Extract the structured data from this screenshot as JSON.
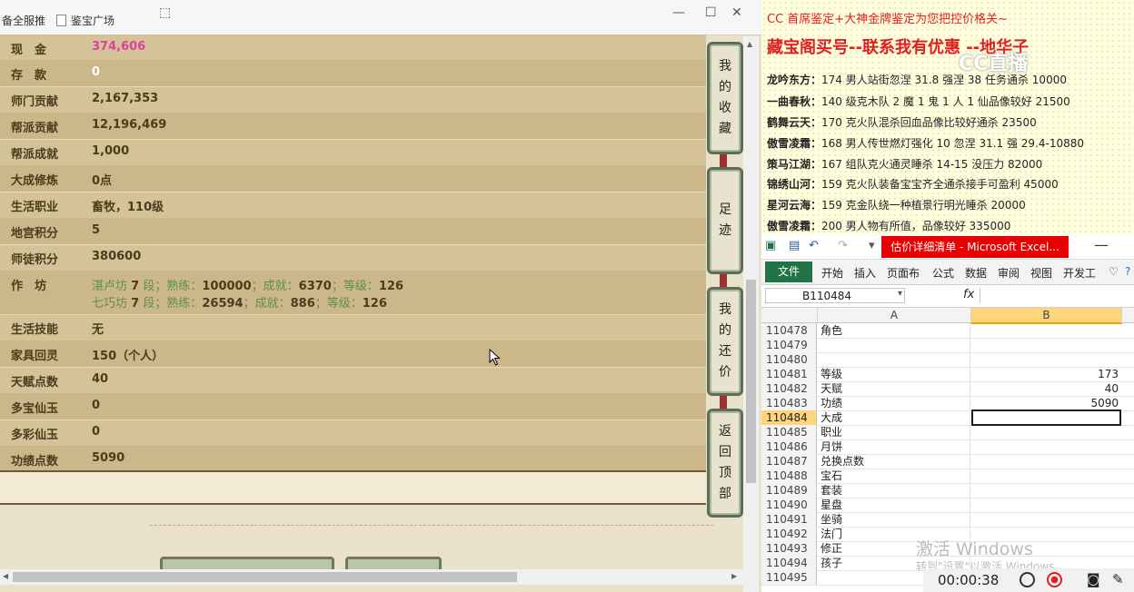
{
  "favorites_bar": {
    "item1": "备全服推",
    "item2": "鉴宝广场"
  },
  "info_rows": [
    {
      "label": "现　金",
      "value": "374,606"
    },
    {
      "label": "存　款",
      "value": "0"
    },
    {
      "label": "师门贡献",
      "value": "2,167,353"
    },
    {
      "label": "帮派贡献",
      "value": "12,196,469"
    },
    {
      "label": "帮派成就",
      "value": "1,000"
    },
    {
      "label": "大成修炼",
      "value": "0点"
    },
    {
      "label": "生活职业",
      "value": "畜牧，110级"
    },
    {
      "label": "地宫积分",
      "value": "5"
    },
    {
      "label": "师徒积分",
      "value": "380600"
    }
  ],
  "workshop": {
    "label": "作　坊",
    "line1": {
      "name": "湛卢坊",
      "rank": "7",
      "rank_unit": "段；熟练：",
      "skill": "100000",
      "ach_label": "；成就：",
      "ach": "6370",
      "lvl_label": "；等级：",
      "lvl": "126"
    },
    "line2": {
      "name": "七巧坊",
      "rank": "7",
      "rank_unit": "段；熟练：",
      "skill": "26594",
      "ach_label": "；成就：",
      "ach": "886",
      "lvl_label": "；等级：",
      "lvl": "126"
    }
  },
  "info_rows2": [
    {
      "label": "生活技能",
      "value": "无"
    },
    {
      "label": "家具回灵",
      "value": "150（个人）"
    },
    {
      "label": "天赋点数",
      "value": "40"
    },
    {
      "label": "多宝仙玉",
      "value": "0"
    },
    {
      "label": "多彩仙玉",
      "value": "0"
    },
    {
      "label": "功绩点数",
      "value": "5090"
    }
  ],
  "side_buttons": [
    {
      "label": "我的收藏",
      "chars": [
        "我",
        "的",
        "收",
        "藏"
      ]
    },
    {
      "label": "足迹",
      "chars": [
        "足",
        "迹"
      ]
    },
    {
      "label": "我的还价",
      "chars": [
        "我",
        "的",
        "还",
        "价"
      ]
    },
    {
      "label": "返回顶部",
      "chars": [
        "返",
        "回",
        "顶",
        "部"
      ]
    }
  ],
  "doc": {
    "line1": "CC 首席鉴定+大神金牌鉴定为您把控价格关~",
    "line2": "藏宝阁买号--联系我有优惠 --地华子",
    "items": [
      {
        "name": "龙吟东方：",
        "text": "174 男人站街忽涅 31.8 强涅 38 任务通杀 10000"
      },
      {
        "name": "一曲春秋：",
        "text": "140 级克木队 2 魔 1 鬼 1 人 1 仙品像较好 21500"
      },
      {
        "name": "鹤舞云天：",
        "text": "170 克火队混杀回血品像比较好通杀 23500"
      },
      {
        "name": "傲雪凌霜：",
        "text": "168 男人传世燃灯强化 10 忽涅 31.1 强 29.4-10880"
      },
      {
        "name": "策马江湖：",
        "text": "167 组队克火通灵睡杀 14-15 没压力 82000"
      },
      {
        "name": "锦绣山河：",
        "text": "159 克火队装备宝宝齐全通杀接手可盈利 45000"
      },
      {
        "name": "星河云海：",
        "text": "159 克金队绕一种植景行明光睡杀 20000"
      },
      {
        "name": "傲雪凌霜：",
        "text": "200 男人物有所值，品像较好 335000"
      }
    ],
    "logo": "CC直播"
  },
  "excel": {
    "title": "估价详细清单 - Microsoft Excel...",
    "tabs": [
      "文件",
      "开始",
      "插入",
      "页面布局",
      "公式",
      "数据",
      "审阅",
      "视图",
      "开发工具"
    ],
    "tabs_display": [
      "文件",
      "开始",
      "插入",
      "页面布",
      "公式",
      "数据",
      "审阅",
      "视图",
      "开发工"
    ],
    "name_box": "B110484",
    "fx": "fx",
    "col_a": "A",
    "col_b": "B",
    "rows": [
      {
        "n": "110478",
        "a": "角色",
        "b": ""
      },
      {
        "n": "110479",
        "a": "",
        "b": ""
      },
      {
        "n": "110480",
        "a": "",
        "b": ""
      },
      {
        "n": "110481",
        "a": "等级",
        "b": "173"
      },
      {
        "n": "110482",
        "a": "天赋",
        "b": "40"
      },
      {
        "n": "110483",
        "a": "功绩",
        "b": "5090"
      },
      {
        "n": "110484",
        "a": "大成",
        "b": ""
      },
      {
        "n": "110485",
        "a": "职业",
        "b": ""
      },
      {
        "n": "110486",
        "a": "月饼",
        "b": ""
      },
      {
        "n": "110487",
        "a": "兑换点数",
        "b": ""
      },
      {
        "n": "110488",
        "a": "宝石",
        "b": ""
      },
      {
        "n": "110489",
        "a": "套装",
        "b": ""
      },
      {
        "n": "110490",
        "a": "星盘",
        "b": ""
      },
      {
        "n": "110491",
        "a": "坐骑",
        "b": ""
      },
      {
        "n": "110492",
        "a": "法门",
        "b": ""
      },
      {
        "n": "110493",
        "a": "修正",
        "b": ""
      },
      {
        "n": "110494",
        "a": "孩子",
        "b": ""
      },
      {
        "n": "110495",
        "a": "",
        "b": ""
      }
    ],
    "selected_row": "110484"
  },
  "watermark": {
    "line1": "激活 Windows",
    "line2": "转到\"设置\"以激活 Windows。"
  },
  "recorder": {
    "time": "00:00:38"
  },
  "colors": {
    "panel_bg": "#d4c298",
    "label_brown": "#4a3c1c",
    "pink_value": "#e0409b",
    "green_workshop": "#5e8f4a",
    "doc_red": "#e0201f",
    "excel_green": "#217346",
    "excel_title_red": "#e80000"
  }
}
